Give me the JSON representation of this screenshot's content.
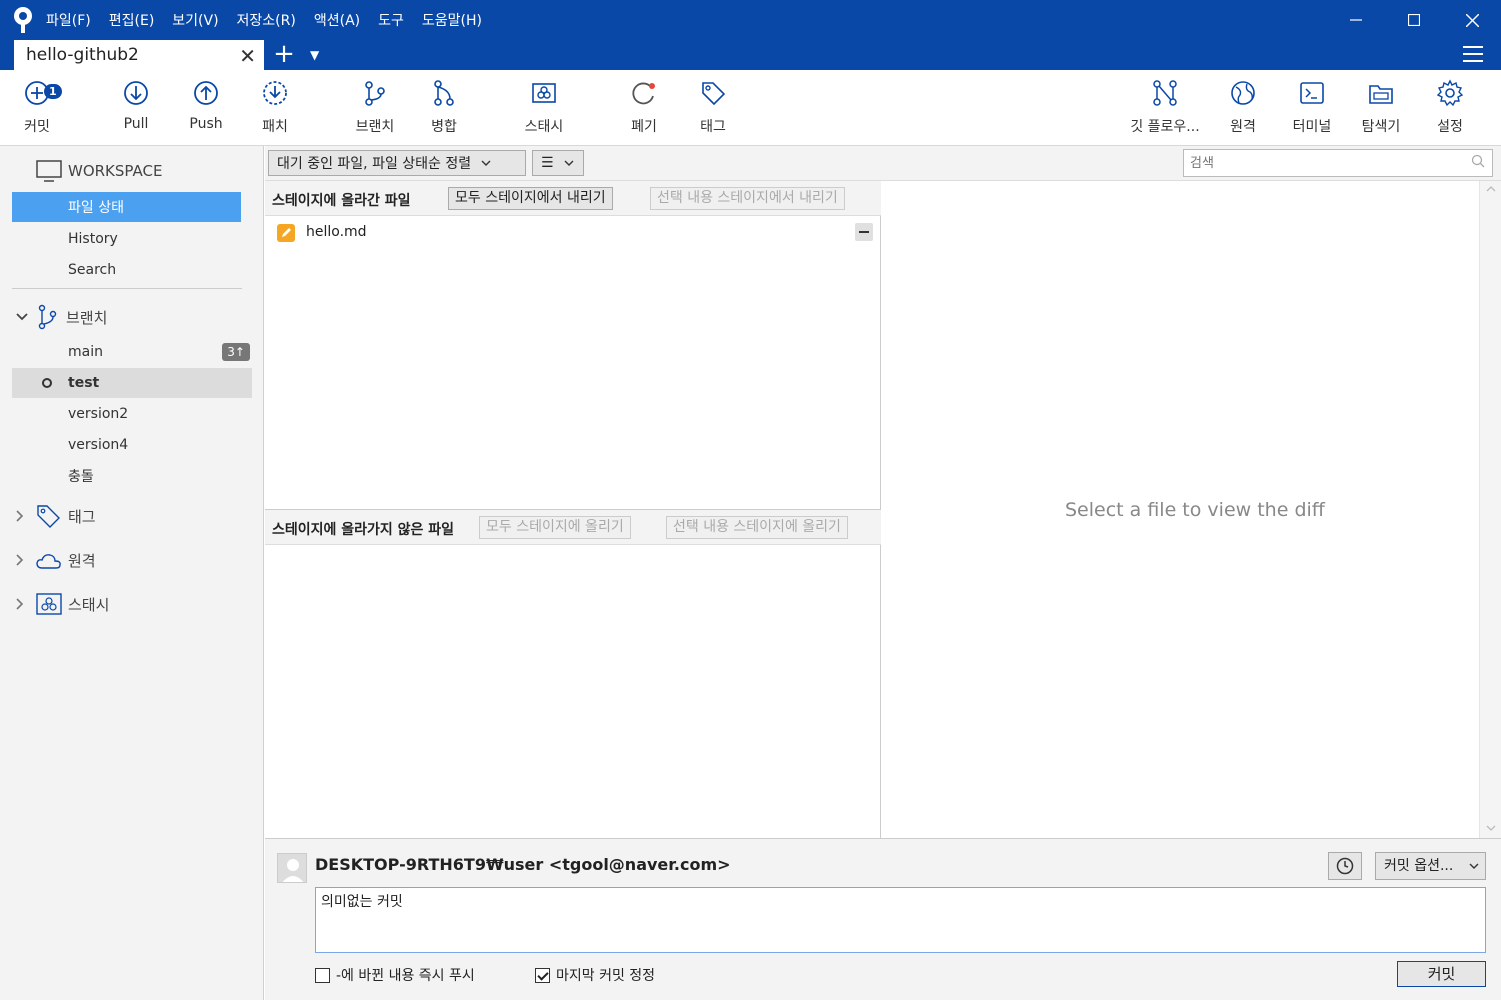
{
  "menu": [
    "파일(F)",
    "편집(E)",
    "보기(V)",
    "저장소(R)",
    "액션(A)",
    "도구",
    "도움말(H)"
  ],
  "window": {
    "minimize": "—",
    "maximize": "☐",
    "close": "✕"
  },
  "tab": {
    "title": "hello-github2",
    "close": "✕",
    "add": "+",
    "dropdown": "▼"
  },
  "toolbar": {
    "commit": {
      "label": "커밋",
      "badge": "1"
    },
    "pull": "Pull",
    "push": "Push",
    "patch": "패치",
    "branch": "브랜치",
    "merge": "병합",
    "stash": "스태시",
    "discard": "폐기",
    "tag": "태그",
    "gitflow": "깃 플로우...",
    "remote": "원격",
    "terminal": "터미널",
    "explorer": "탐색기",
    "settings": "설정"
  },
  "sidebar": {
    "workspace": "WORKSPACE",
    "workspace_items": [
      "파일 상태",
      "History",
      "Search"
    ],
    "branches": "브랜치",
    "branch_items": [
      {
        "name": "main",
        "badge": "3↑"
      },
      {
        "name": "test"
      },
      {
        "name": "version2"
      },
      {
        "name": "version4"
      },
      {
        "name": "충돌"
      }
    ],
    "tags": "태그",
    "remotes": "원격",
    "stashes": "스태시"
  },
  "filter": {
    "sort": "대기 중인 파일, 파일 상태순 정렬",
    "view": "☰",
    "search_placeholder": "검색"
  },
  "staged": {
    "title": "스테이지에 올라간 파일",
    "unstage_all": "모두 스테이지에서 내리기",
    "unstage_selected": "선택 내용 스테이지에서 내리기",
    "files": [
      "hello.md"
    ]
  },
  "unstaged": {
    "title": "스테이지에 올라가지 않은 파일",
    "stage_all": "모두 스테이지에 올리기",
    "stage_selected": "선택 내용 스테이지에 올리기"
  },
  "diff": {
    "empty": "Select a file to view the diff"
  },
  "commit": {
    "author": "DESKTOP-9RTH6T9₩user <tgool@naver.com>",
    "options": "커밋 옵션...",
    "message": "의미없는 커밋",
    "push_now": "-에 바뀐 내용 즉시 푸시",
    "amend": "마지막 커밋 정정",
    "button": "커밋"
  },
  "colors": {
    "titlebar": "#0a48a8",
    "selected": "#4ba0f0",
    "accent": "#0a48a8"
  }
}
